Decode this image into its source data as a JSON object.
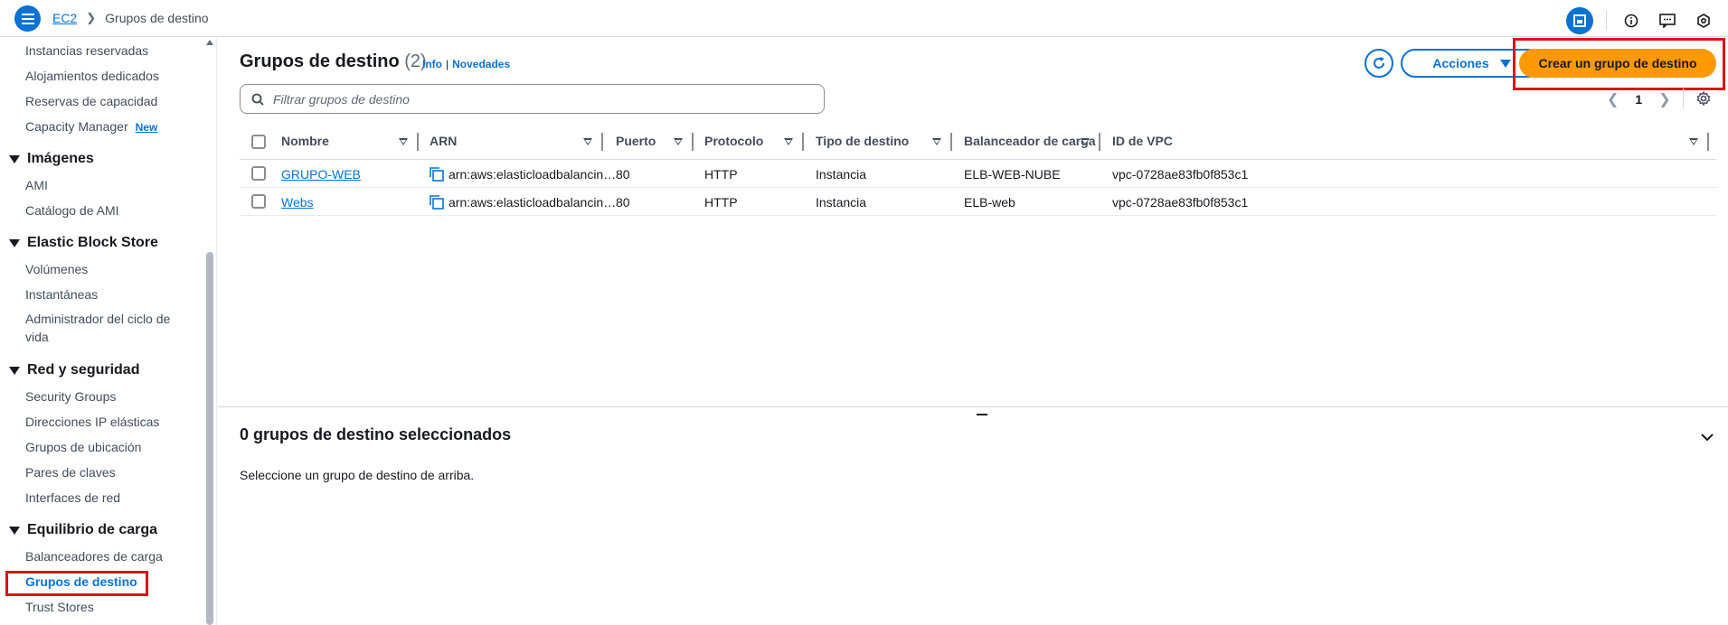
{
  "breadcrumb": {
    "service": "EC2",
    "current": "Grupos de destino"
  },
  "sidebar": {
    "items_top": [
      "Instancias reservadas",
      "Alojamientos dedicados",
      "Reservas de capacidad",
      "Capacity Manager"
    ],
    "new_badge": "New",
    "sections": [
      {
        "title": "Imágenes",
        "items": [
          "AMI",
          "Catálogo de AMI"
        ]
      },
      {
        "title": "Elastic Block Store",
        "items": [
          "Volúmenes",
          "Instantáneas",
          "Administrador del ciclo de vida"
        ]
      },
      {
        "title": "Red y seguridad",
        "items": [
          "Security Groups",
          "Direcciones IP elásticas",
          "Grupos de ubicación",
          "Pares de claves",
          "Interfaces de red"
        ]
      },
      {
        "title": "Equilibrio de carga",
        "items": [
          "Balanceadores de carga",
          "Grupos de destino",
          "Trust Stores"
        ]
      }
    ],
    "active_item": "Grupos de destino"
  },
  "header": {
    "title": "Grupos de destino",
    "count": "(2)",
    "info_link": "Info",
    "separator": "|",
    "news_link": "Novedades",
    "actions_label": "Acciones",
    "create_label": "Crear un grupo de destino"
  },
  "search": {
    "placeholder": "Filtrar grupos de destino"
  },
  "pagination": {
    "page": "1"
  },
  "table": {
    "columns": [
      "Nombre",
      "ARN",
      "Puerto",
      "Protocolo",
      "Tipo de destino",
      "Balanceador de carga",
      "ID de VPC"
    ],
    "rows": [
      {
        "name": "GRUPO-WEB",
        "arn": "arn:aws:elasticloadbalancin…",
        "port": "80",
        "protocol": "HTTP",
        "target_type": "Instancia",
        "lb": "ELB-WEB-NUBE",
        "vpc": "vpc-0728ae83fb0f853c1"
      },
      {
        "name": "Webs",
        "arn": "arn:aws:elasticloadbalancin…",
        "port": "80",
        "protocol": "HTTP",
        "target_type": "Instancia",
        "lb": "ELB-web",
        "vpc": "vpc-0728ae83fb0f853c1"
      }
    ]
  },
  "details": {
    "title": "0 grupos de destino seleccionados",
    "body": "Seleccione un grupo de destino de arriba."
  },
  "colors": {
    "accent": "#0972d3",
    "primary_button": "#ff9900",
    "highlight": "#d91515"
  },
  "icons": [
    "menu-icon",
    "chevron-right-icon",
    "panel-icon",
    "info-icon",
    "feedback-icon",
    "settings-hex-icon",
    "refresh-icon",
    "search-icon",
    "copy-icon",
    "gear-icon",
    "chevron-down-icon"
  ]
}
